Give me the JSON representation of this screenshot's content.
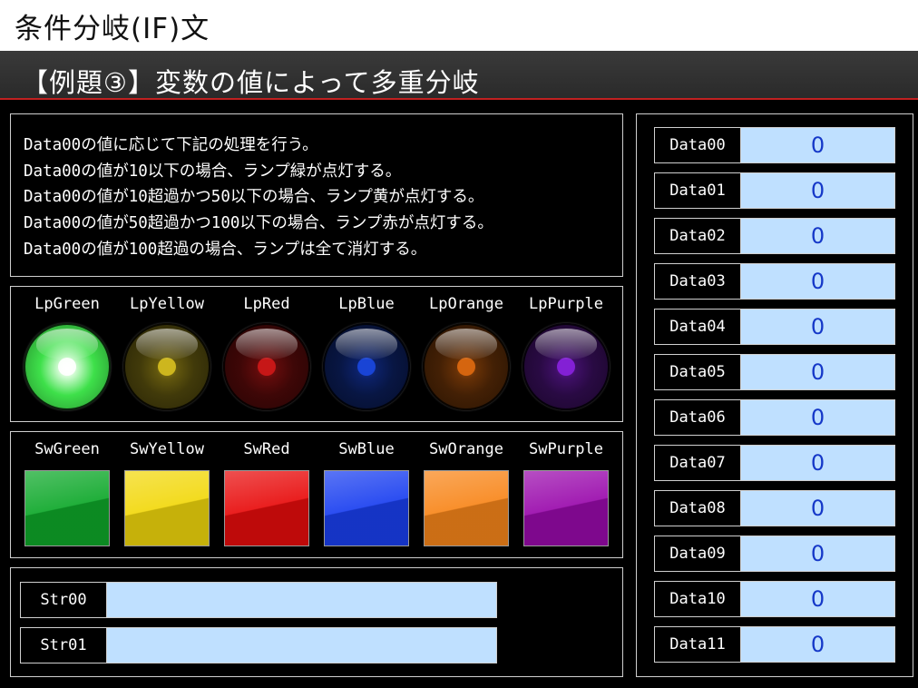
{
  "header": {
    "title": "条件分岐(IF)文"
  },
  "subheader": {
    "title": "【例題③】変数の値によって多重分岐"
  },
  "description": {
    "lines": [
      "Data00の値に応じて下記の処理を行う。",
      "Data00の値が10以下の場合、ランプ緑が点灯する。",
      "Data00の値が10超過かつ50以下の場合、ランプ黄が点灯する。",
      "Data00の値が50超過かつ100以下の場合、ランプ赤が点灯する。",
      "Data00の値が100超過の場合、ランプは全て消灯する。"
    ]
  },
  "lamps": [
    {
      "label": "LpGreen",
      "state": "on",
      "color": "#3ee04a"
    },
    {
      "label": "LpYellow",
      "state": "off",
      "color": "#d8c020"
    },
    {
      "label": "LpRed",
      "state": "off",
      "color": "#d01818"
    },
    {
      "label": "LpBlue",
      "state": "off",
      "color": "#1a48e0"
    },
    {
      "label": "LpOrange",
      "state": "off",
      "color": "#e06a10"
    },
    {
      "label": "LpPurple",
      "state": "off",
      "color": "#8a22e0"
    }
  ],
  "switches": [
    {
      "label": "SwGreen",
      "color": "#0ea82a"
    },
    {
      "label": "SwYellow",
      "color": "#f2d80c"
    },
    {
      "label": "SwRed",
      "color": "#e80c0c"
    },
    {
      "label": "SwBlue",
      "color": "#1a3ff0"
    },
    {
      "label": "SwOrange",
      "color": "#f8861a"
    },
    {
      "label": "SwPurple",
      "color": "#9a0aac"
    }
  ],
  "strings": [
    {
      "label": "Str00",
      "value": ""
    },
    {
      "label": "Str01",
      "value": ""
    }
  ],
  "data": [
    {
      "label": "Data00",
      "value": "0"
    },
    {
      "label": "Data01",
      "value": "0"
    },
    {
      "label": "Data02",
      "value": "0"
    },
    {
      "label": "Data03",
      "value": "0"
    },
    {
      "label": "Data04",
      "value": "0"
    },
    {
      "label": "Data05",
      "value": "0"
    },
    {
      "label": "Data06",
      "value": "0"
    },
    {
      "label": "Data07",
      "value": "0"
    },
    {
      "label": "Data08",
      "value": "0"
    },
    {
      "label": "Data09",
      "value": "0"
    },
    {
      "label": "Data10",
      "value": "0"
    },
    {
      "label": "Data11",
      "value": "0"
    }
  ]
}
